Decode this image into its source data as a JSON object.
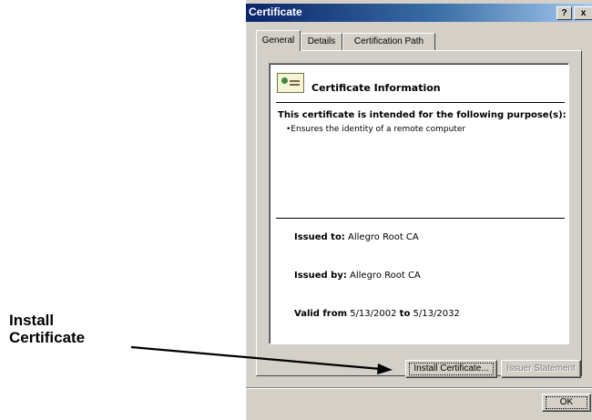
{
  "annotation": {
    "line1": "Install",
    "line2": "Certificate"
  },
  "window": {
    "title": "Certificate",
    "help_label": "?",
    "close_label": "x"
  },
  "tabs": [
    {
      "label": "General",
      "active": true
    },
    {
      "label": "Details",
      "active": false
    },
    {
      "label": "Certification Path",
      "active": false
    }
  ],
  "certificate": {
    "heading": "Certificate Information",
    "purpose_heading": "This certificate is intended for the following purpose(s):",
    "purpose_item": "•Ensures the identity of a remote computer",
    "issued_to_label": "Issued to:",
    "issued_to_value": "Allegro Root CA",
    "issued_by_label": "Issued by:",
    "issued_by_value": "Allegro Root CA",
    "valid_from_label": "Valid from",
    "valid_from_value": "5/13/2002",
    "to_label": "to",
    "valid_to_value": "5/13/2032"
  },
  "buttons": {
    "install": "Install Certificate...",
    "issuer": "Issuer Statement",
    "ok": "OK"
  },
  "icons": {
    "certificate": "certificate-icon"
  }
}
